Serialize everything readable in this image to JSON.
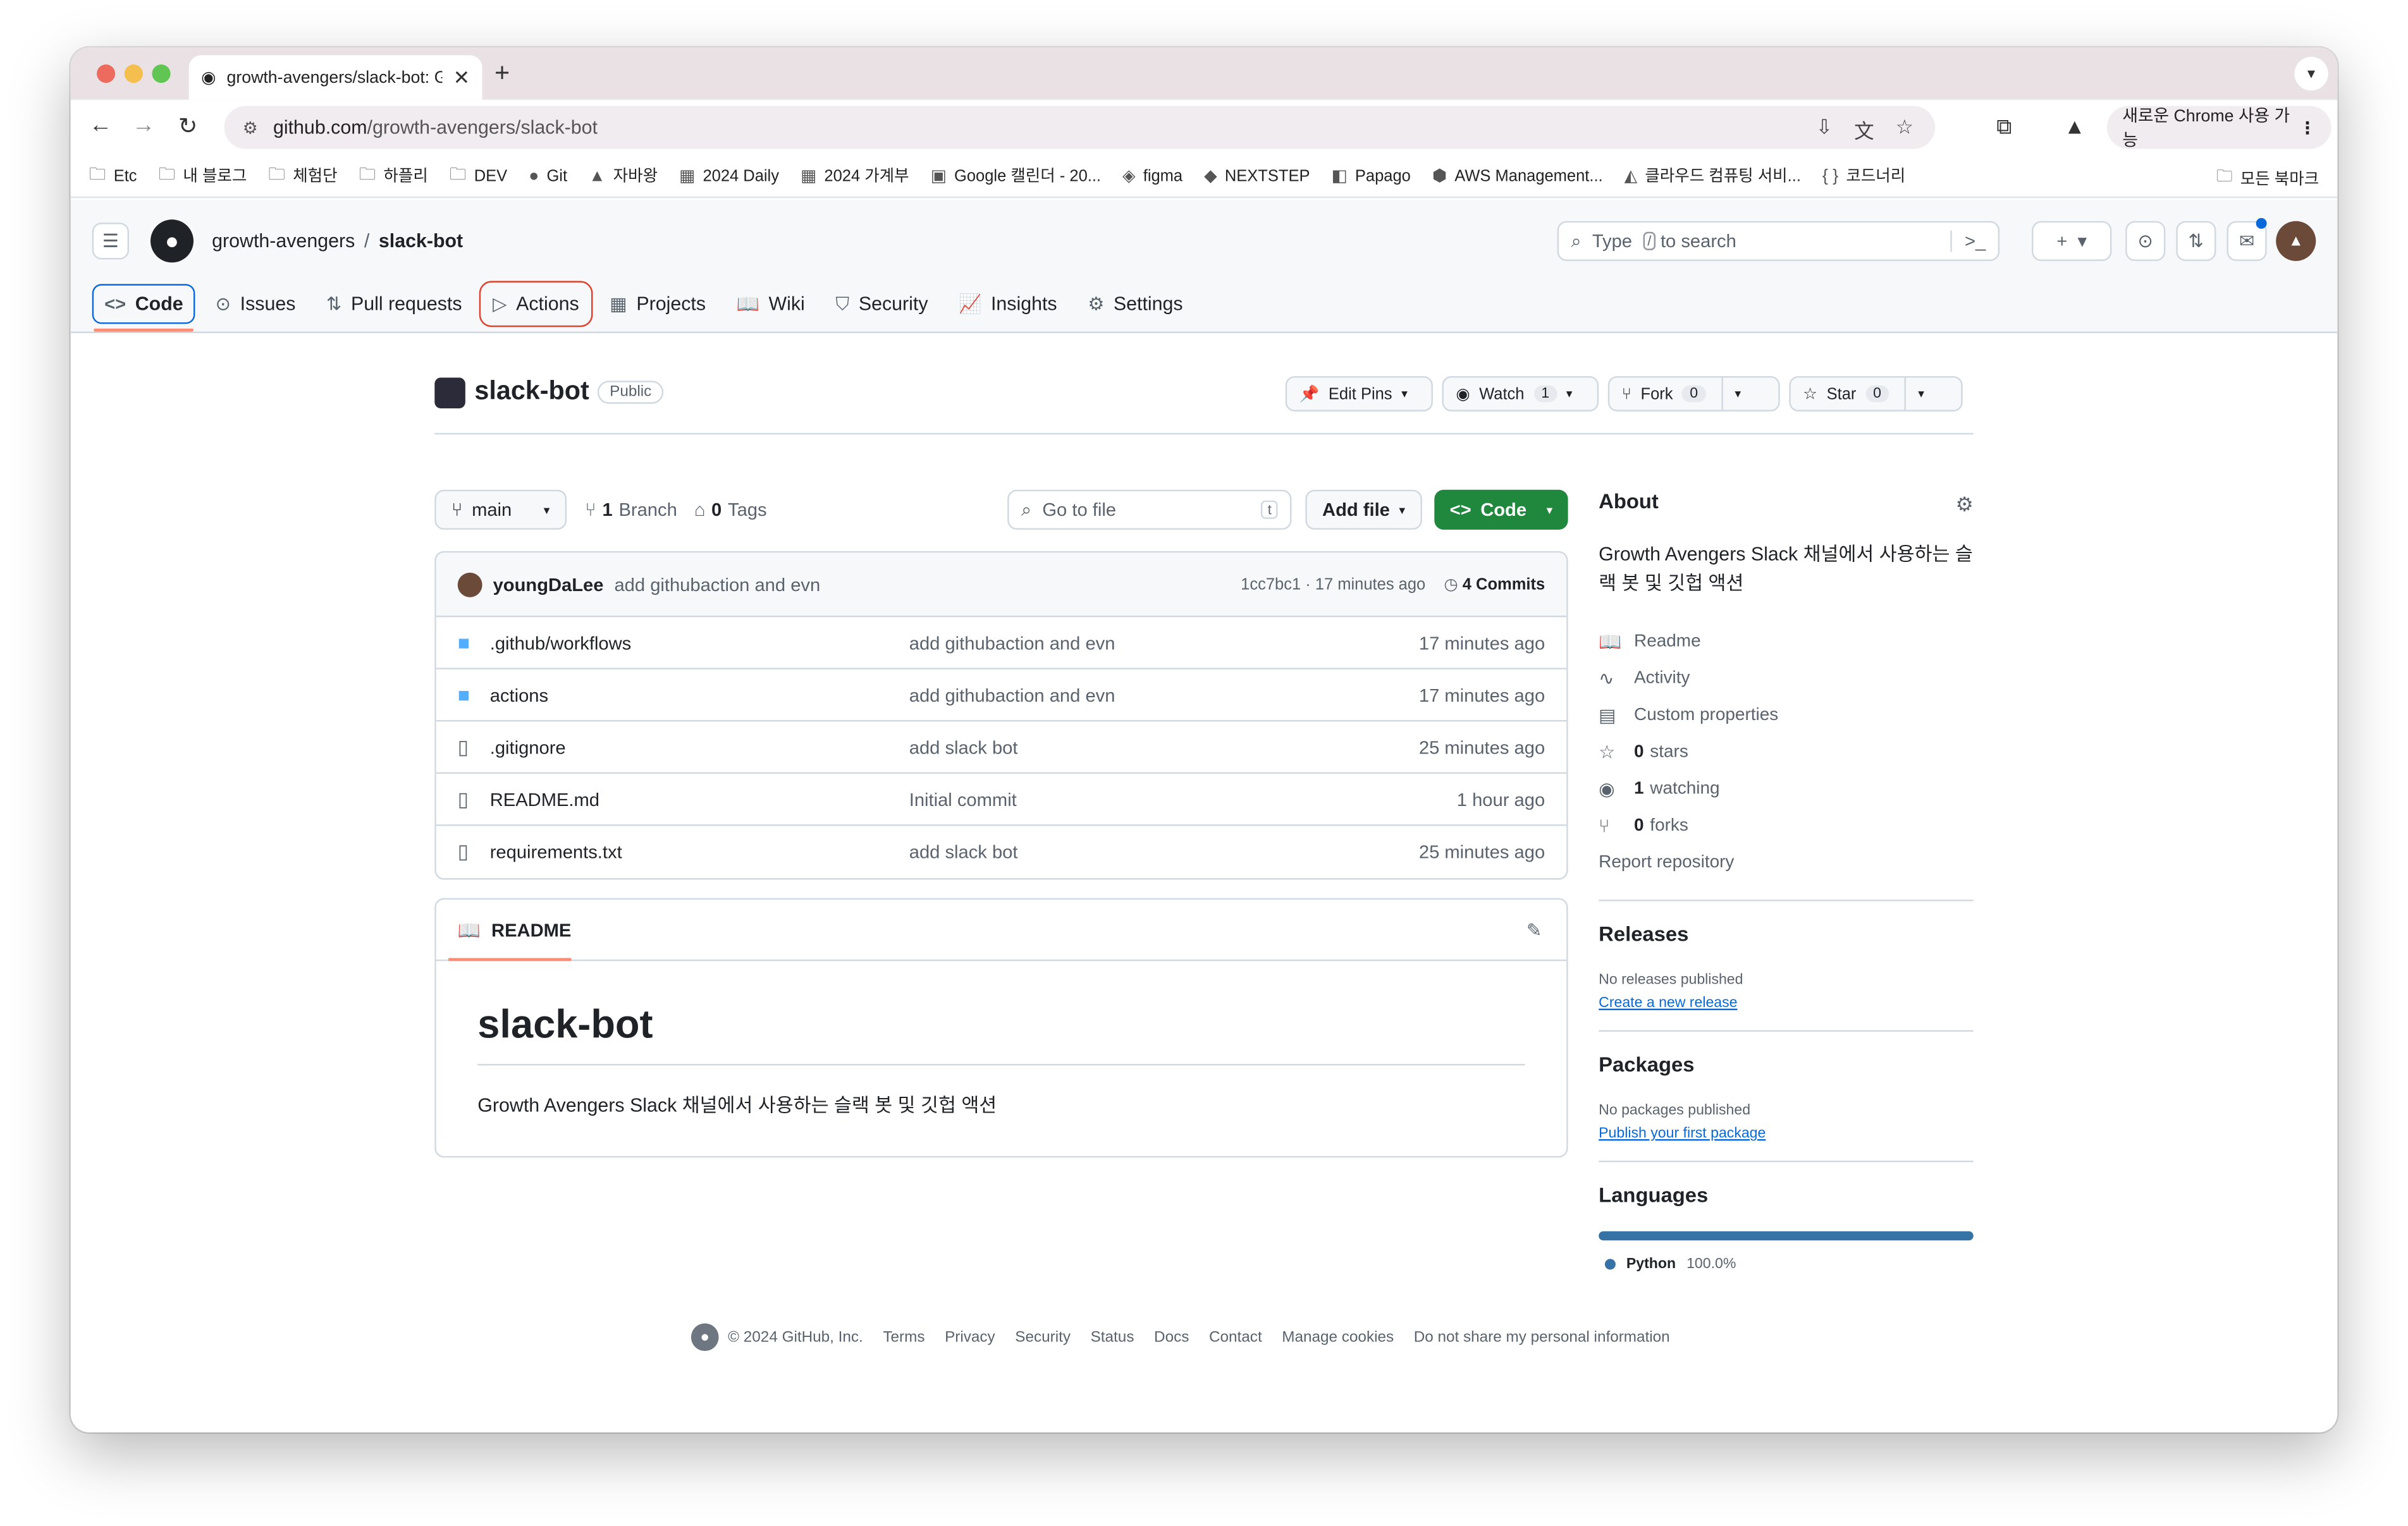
{
  "browser": {
    "tab_title": "growth-avengers/slack-bot: G",
    "tab_close": "✕",
    "new_tab": "+",
    "url_host": "github.com",
    "url_path": "/growth-avengers/slack-bot",
    "chrome_pill": "새로운 Chrome 사용 가능",
    "bookmarks": [
      {
        "label": "Etc",
        "icon": "folder-icon"
      },
      {
        "label": "내 블로그",
        "icon": "folder-icon"
      },
      {
        "label": "체험단",
        "icon": "folder-icon"
      },
      {
        "label": "하플리",
        "icon": "folder-icon"
      },
      {
        "label": "DEV",
        "icon": "folder-icon"
      },
      {
        "label": "Git",
        "icon": "github-icon"
      },
      {
        "label": "자바왕",
        "icon": "drive-icon"
      },
      {
        "label": "2024 Daily",
        "icon": "sheets-icon"
      },
      {
        "label": "2024 가계부",
        "icon": "sheets-icon"
      },
      {
        "label": "Google 캘린더 - 20...",
        "icon": "calendar-icon"
      },
      {
        "label": "figma",
        "icon": "figma-icon"
      },
      {
        "label": "NEXTSTEP",
        "icon": "nextstep-icon"
      },
      {
        "label": "Papago",
        "icon": "papago-icon"
      },
      {
        "label": "AWS Management...",
        "icon": "aws-icon"
      },
      {
        "label": "클라우드 컴퓨팅 서비...",
        "icon": "cloud-icon"
      },
      {
        "label": "코드너리",
        "icon": "braces-icon"
      }
    ],
    "all_bookmarks": "모든 북마크"
  },
  "github": {
    "owner": "growth-avengers",
    "separator": "/",
    "repo": "slack-bot",
    "search_prefix": "Type",
    "search_key": "/",
    "search_suffix": "to search",
    "tabs": [
      {
        "label": "Code",
        "icon": "code-icon"
      },
      {
        "label": "Issues",
        "icon": "issue-icon"
      },
      {
        "label": "Pull requests",
        "icon": "pull-request-icon"
      },
      {
        "label": "Actions",
        "icon": "play-icon"
      },
      {
        "label": "Projects",
        "icon": "table-icon"
      },
      {
        "label": "Wiki",
        "icon": "book-icon"
      },
      {
        "label": "Security",
        "icon": "shield-icon"
      },
      {
        "label": "Insights",
        "icon": "graph-icon"
      },
      {
        "label": "Settings",
        "icon": "gear-icon"
      }
    ]
  },
  "repo": {
    "name": "slack-bot",
    "visibility": "Public",
    "edit_pins": "Edit Pins",
    "watch": "Watch",
    "watch_count": "1",
    "fork": "Fork",
    "fork_count": "0",
    "star": "Star",
    "star_count": "0",
    "branch": "main",
    "branch_count": "1",
    "branch_label": "Branch",
    "tag_count": "0",
    "tag_label": "Tags",
    "goto_file": "Go to file",
    "goto_key": "t",
    "add_file": "Add file",
    "code_btn": "Code"
  },
  "commit": {
    "author": "youngDaLee",
    "message": "add githubaction and evn",
    "sha": "1cc7bc1",
    "dot": "·",
    "age": "17 minutes ago",
    "commits_count": "4",
    "commits_label": "Commits"
  },
  "files": [
    {
      "name": ".github/workflows",
      "type": "folder",
      "message": "add githubaction and evn",
      "age": "17 minutes ago"
    },
    {
      "name": "actions",
      "type": "folder",
      "message": "add githubaction and evn",
      "age": "17 minutes ago"
    },
    {
      "name": ".gitignore",
      "type": "file",
      "message": "add slack bot",
      "age": "25 minutes ago"
    },
    {
      "name": "README.md",
      "type": "file",
      "message": "Initial commit",
      "age": "1 hour ago"
    },
    {
      "name": "requirements.txt",
      "type": "file",
      "message": "add slack bot",
      "age": "25 minutes ago"
    }
  ],
  "readme": {
    "tab": "README",
    "heading": "slack-bot",
    "description": "Growth Avengers Slack 채널에서 사용하는 슬랙 봇 및 깃헙 액션"
  },
  "about": {
    "title": "About",
    "description": "Growth Avengers Slack 채널에서 사용하는 슬랙 봇 및 깃헙 액션",
    "readme": "Readme",
    "activity": "Activity",
    "custom_properties": "Custom properties",
    "stars_count": "0",
    "stars_label": "stars",
    "watching_count": "1",
    "watching_label": "watching",
    "forks_count": "0",
    "forks_label": "forks",
    "report": "Report repository"
  },
  "releases": {
    "title": "Releases",
    "none": "No releases published",
    "link": "Create a new release"
  },
  "packages": {
    "title": "Packages",
    "none": "No packages published",
    "link": "Publish your first package"
  },
  "languages": {
    "title": "Languages",
    "name": "Python",
    "percent": "100.0%",
    "color": "#3572a5",
    "share": 1.0
  },
  "footer": {
    "copyright": "© 2024 GitHub, Inc.",
    "links": [
      "Terms",
      "Privacy",
      "Security",
      "Status",
      "Docs",
      "Contact",
      "Manage cookies",
      "Do not share my personal information"
    ]
  }
}
